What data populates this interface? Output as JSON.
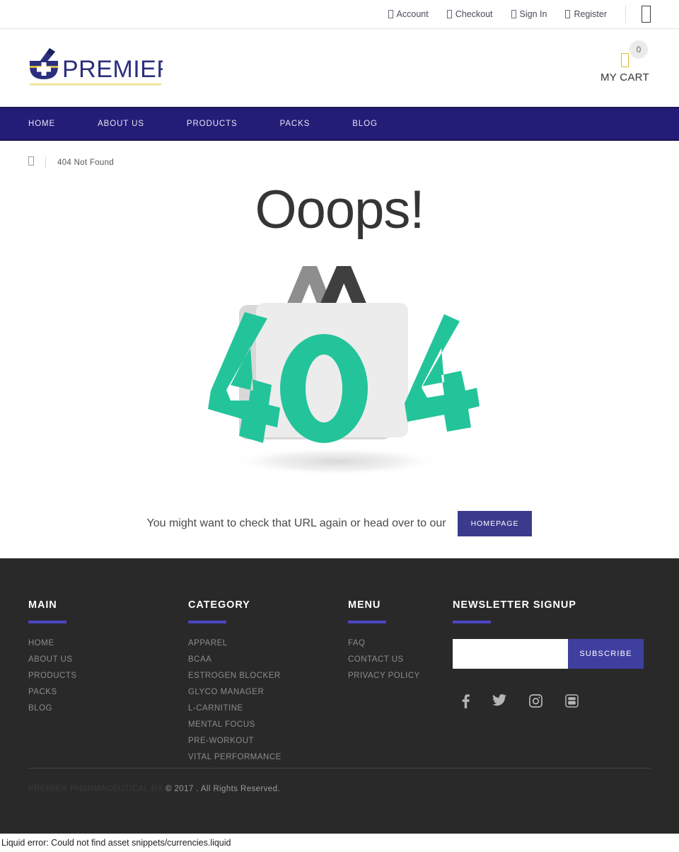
{
  "topbar": {
    "links": [
      {
        "label": "Account",
        "icon": "user-icon"
      },
      {
        "label": "Checkout",
        "icon": "cart-icon"
      },
      {
        "label": "Sign In",
        "icon": "signin-icon"
      },
      {
        "label": "Register",
        "icon": "register-icon"
      }
    ],
    "menu_icon": "menu-glyph-icon"
  },
  "header": {
    "logo_text": "PREMIER",
    "logo_alt": "Premier Pharmaceutical RX",
    "cart_count": "0",
    "cart_label": "MY CART"
  },
  "nav": {
    "items": [
      {
        "label": "HOME"
      },
      {
        "label": "ABOUT US"
      },
      {
        "label": "PRODUCTS"
      },
      {
        "label": "PACKS"
      },
      {
        "label": "BLOG"
      }
    ]
  },
  "breadcrumb": {
    "home_icon": "home-icon",
    "current": "404 Not Found"
  },
  "main": {
    "heading": "Ooops!",
    "graphic_label": "404",
    "hint_text": "You might want to check that URL again or head over to our",
    "homepage_button": "HOMEPAGE"
  },
  "footer": {
    "columns": [
      {
        "title": "MAIN",
        "links": [
          "HOME",
          "ABOUT US",
          "PRODUCTS",
          "PACKS",
          "BLOG"
        ]
      },
      {
        "title": "CATEGORY",
        "links": [
          "APPAREL",
          "BCAA",
          "ESTROGEN BLOCKER",
          "GLYCO MANAGER",
          "L-CARNITINE",
          "MENTAL FOCUS",
          "PRE-WORKOUT",
          "VITAL PERFORMANCE"
        ]
      },
      {
        "title": "MENU",
        "links": [
          "FAQ",
          "CONTACT US",
          "PRIVACY POLICY"
        ]
      }
    ],
    "newsletter": {
      "title": "NEWSLETTER SIGNUP",
      "input_value": "",
      "input_placeholder": "",
      "subscribe_label": "SUBSCRIBE"
    },
    "socials": [
      {
        "name": "facebook-icon"
      },
      {
        "name": "twitter-icon"
      },
      {
        "name": "instagram-icon"
      },
      {
        "name": "youtube-icon"
      }
    ],
    "copyright_brand": "PREMIER PHARMACEUTICAL RX",
    "copyright_rest": "© 2017 . All Rights Reserved."
  },
  "status": {
    "liquid_error": "Liquid error: Could not find asset snippets/currencies.liquid"
  },
  "colors": {
    "nav_navy": "#241d77",
    "accent_indigo": "#4b46c4",
    "button_navy": "#3b3a8c",
    "subscribe_blue": "#3f3fa0",
    "footer_dark": "#2a2929",
    "logo_gold": "#e0b93c",
    "graphic_teal": "#23c49a"
  }
}
